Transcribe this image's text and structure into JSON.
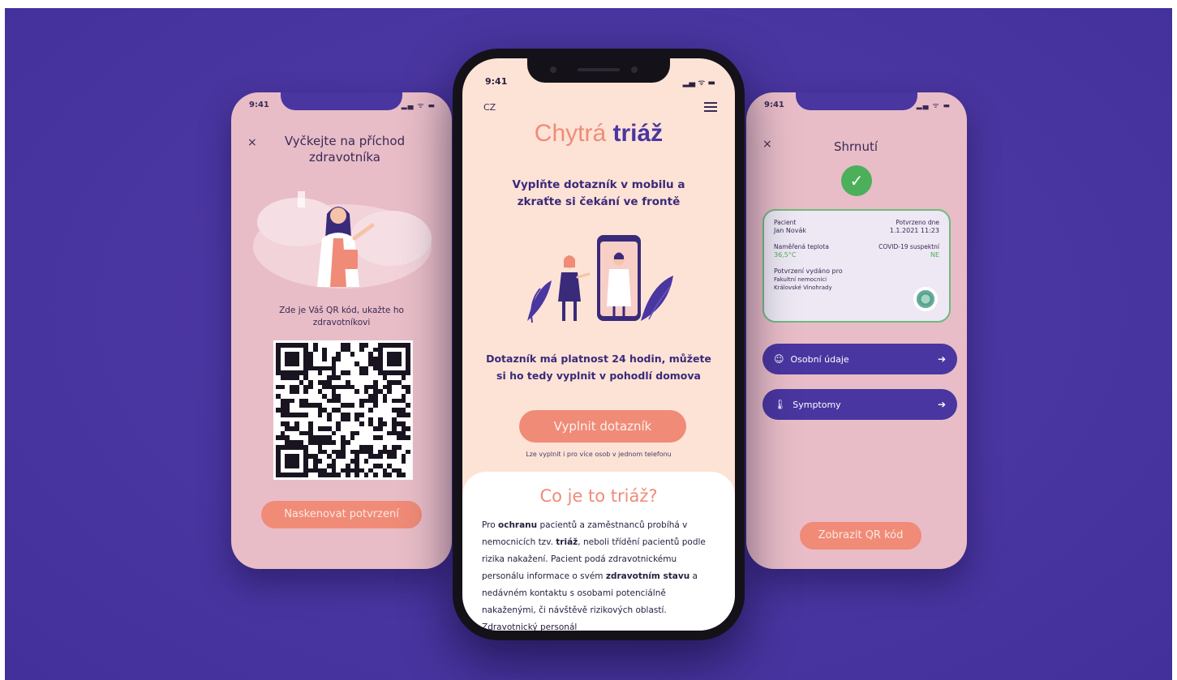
{
  "left_screen": {
    "time": "9:41",
    "status": "▂▄ ᯤ ▬",
    "close_glyph": "×",
    "title": "Vyčkejte na příchod zdravotníka",
    "qr_caption": "Zde je Váš QR kód, ukažte ho zdravotníkovi",
    "scan_button": "Naskenovat potvrzení"
  },
  "center_screen": {
    "time": "9:41",
    "status": "▂▄ ᯤ ▬",
    "language": "CZ",
    "logo_light": "Chytrá",
    "logo_strong": "triáž",
    "headline": "Vyplňte dotazník v mobilu a zkraťte si čekání ve frontě",
    "validity": "Dotazník má platnost 24 hodin, můžete si ho tedy vyplnit v pohodlí domova",
    "fill_button": "Vyplnit dotazník",
    "fill_note": "Lze vyplnit i pro více osob v jednom telefonu",
    "info_title": "Co je to triáž?",
    "info": {
      "p1": "Pro ",
      "b1": "ochranu",
      "p2": " pacientů a zaměstnanců probíhá v nemocnicích tzv. ",
      "b2": "triáž",
      "p3": ", neboli třídění pacientů podle rizika nakažení. Pacient podá zdravotnickému personálu informace o svém ",
      "b3": "zdravotním stavu",
      "p4": " a nedávném kontaktu s osobami potenciálně nakaženými, či návštěvě rizikových oblastí. Zdravotnický personál"
    }
  },
  "right_screen": {
    "time": "9:41",
    "status": "▂▄ ᯤ ▬",
    "close_glyph": "×",
    "title": "Shrnutí",
    "check_glyph": "✓",
    "card": {
      "patient_label": "Pacient",
      "patient_name": "Jan Novák",
      "confirmed_label": "Potvrzeno dne",
      "confirmed_value": "1.1.2021 11:23",
      "temp_label": "Naměřená teplota",
      "temp_value": "36,5°C",
      "covid_label": "COVID-19 suspektní",
      "covid_value": "NE",
      "issued_label": "Potvrzení vydáno pro",
      "issued_org_1": "Fakultní nemocnici",
      "issued_org_2": "Královské Vinohrady"
    },
    "personal_button": "Osobní údaje",
    "symptoms_button": "Symptomy",
    "arrow_glyph": "➔",
    "person_glyph": "☺",
    "thermo_glyph": "🌡",
    "show_qr_button": "Zobrazit QR kód"
  },
  "colors": {
    "background": "#4a36a0",
    "salmon": "#f08b78",
    "side_screen": "#e8bdc7",
    "center_screen": "#fde3d6",
    "green": "#4caf5a"
  }
}
